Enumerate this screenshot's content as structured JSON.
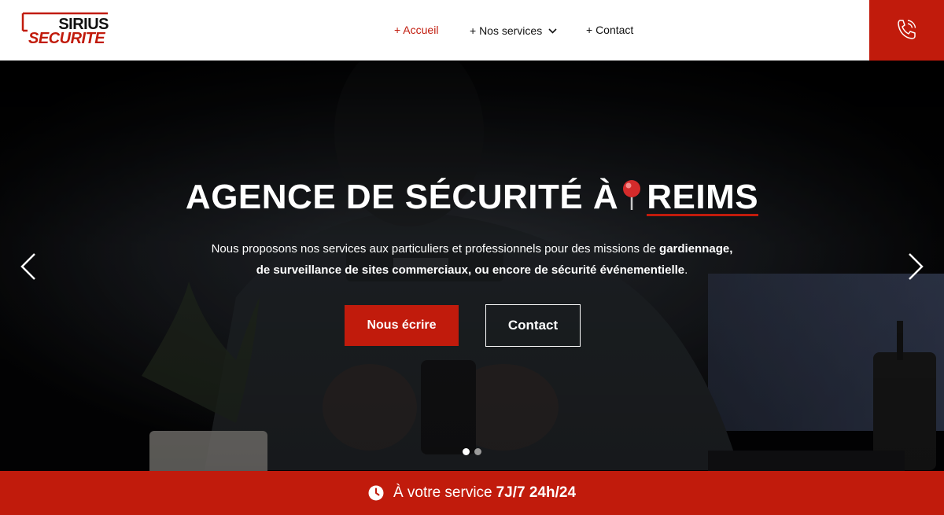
{
  "brand": {
    "line1": "SIRIUS",
    "line2": "SECURITE",
    "accent_color": "#c11b0c"
  },
  "nav": {
    "items": [
      {
        "label": "+ Accueil",
        "active": true
      },
      {
        "label": "+ Nos services",
        "dropdown": true
      },
      {
        "label": "+ Contact"
      }
    ],
    "phone_icon": "phone-call-icon"
  },
  "hero": {
    "title_prefix": "AGENCE DE SÉCURITÉ À",
    "title_city": "REIMS",
    "text_line1_plain": "Nous proposons nos services aux particuliers et professionnels pour des missions de ",
    "text_line1_bold": "gardiennage,",
    "text_line2_bold": "de surveillance de sites commerciaux, ou encore de sécurité événementielle",
    "text_line2_end": ".",
    "primary_button": "Nous écrire",
    "secondary_button": "Contact",
    "slide_count": 2,
    "active_slide": 1
  },
  "bottom_bar": {
    "text": "À votre service",
    "highlight": "7J/7 24h/24",
    "icon": "clock-icon"
  }
}
